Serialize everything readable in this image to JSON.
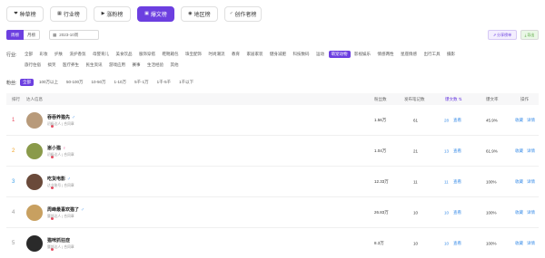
{
  "tabs": [
    {
      "icon": "❤",
      "label": "种草榜",
      "active": false
    },
    {
      "icon": "▦",
      "label": "行业榜",
      "active": false
    },
    {
      "icon": "▶",
      "label": "涨粉榜",
      "active": false
    },
    {
      "icon": "▣",
      "label": "爆文榜",
      "active": true
    },
    {
      "icon": "◉",
      "label": "地区榜",
      "active": false
    },
    {
      "icon": "♂",
      "label": "创作者榜",
      "active": false
    }
  ],
  "controls": {
    "period_on": "周榜",
    "period_off": "月榜",
    "date_value": "2023-10周",
    "share_label": "分享榜单",
    "export_label": "导出"
  },
  "industry": {
    "label": "行业:",
    "row1": [
      "全部",
      "彩妆",
      "护肤",
      "洗护香氛",
      "母婴育儿",
      "美食饮品",
      "服饰穿搭",
      "鞋靴箱包",
      "珠宝配饰",
      "时尚潮流",
      "教育",
      "家居家装",
      "健身减肥",
      "科技数码",
      "运动",
      "萌宠动物",
      "影视娱乐",
      "情感两性",
      "星座情感",
      "出行工具",
      "摄影"
    ],
    "row2": [
      "旅行住宿",
      "搞笑",
      "医疗养生",
      "民生资讯",
      "游戏应用",
      "赛事",
      "生活经验",
      "其他"
    ],
    "active": "萌宠动物"
  },
  "fans": {
    "label": "粉丝:",
    "options": [
      "全部",
      "100万以上",
      "50-100万",
      "10-50万",
      "1-10万",
      "5千-1万",
      "1千-5千",
      "1千以下"
    ],
    "active": "全部"
  },
  "table": {
    "headers": {
      "rank": "排行",
      "info": "达人信息",
      "fans": "粉丝数",
      "notes": "发布笔记数",
      "viral": "爆文数",
      "rate": "爆文率",
      "ops": "操作"
    },
    "rows": [
      {
        "rank": "1",
        "name": "吞吞养猫先",
        "gender": "♂",
        "sub": "初级达人 | 合同章",
        "fans": "1.56万",
        "notes": "61",
        "viral": "28",
        "view": "查看",
        "rate": "45.9%",
        "fav": "收藏",
        "detail": "详情",
        "avatar_color": "#b89a7a"
      },
      {
        "rank": "2",
        "name": "崽小猫",
        "gender": "♀",
        "sub": "初级达人 | 合同章",
        "fans": "1.04万",
        "notes": "21",
        "viral": "13",
        "view": "查看",
        "rate": "61.9%",
        "fav": "收藏",
        "detail": "详情",
        "avatar_color": "#8a9a4a"
      },
      {
        "rank": "3",
        "name": "吃货电影",
        "gender": "♂",
        "sub": "达业账号 | 合同章",
        "fans": "12.33万",
        "notes": "11",
        "viral": "11",
        "view": "查看",
        "rate": "100%",
        "fav": "收藏",
        "detail": "详情",
        "avatar_color": "#6a4a3a"
      },
      {
        "rank": "4",
        "name": "周峰最喜欢猫了",
        "gender": "♂",
        "sub": "腰部达人 | 合同章",
        "fans": "26.83万",
        "notes": "10",
        "viral": "10",
        "view": "查看",
        "rate": "100%",
        "fav": "收藏",
        "detail": "详情",
        "avatar_color": "#c8a060"
      },
      {
        "rank": "5",
        "name": "猫咪抓狂症",
        "gender": "",
        "sub": "腰部达人 | 合同章",
        "fans": "8.3万",
        "notes": "10",
        "viral": "10",
        "view": "查看",
        "rate": "100%",
        "fav": "收藏",
        "detail": "详情",
        "avatar_color": "#2a2a2a"
      }
    ]
  },
  "colors": {
    "accent": "#6c3fe0",
    "link": "#3b8ee8"
  }
}
